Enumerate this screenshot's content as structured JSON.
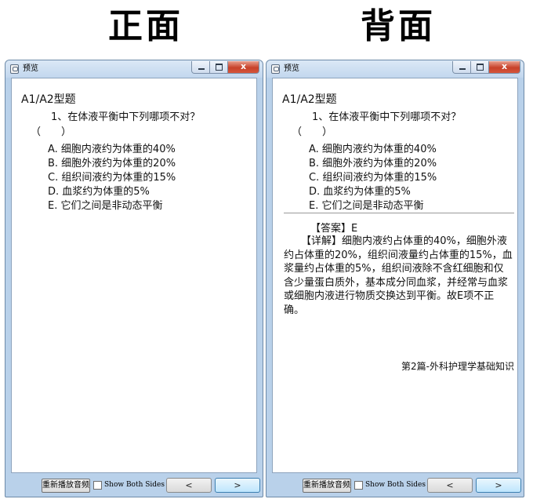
{
  "headings": {
    "front": "正面",
    "back": "背面"
  },
  "window": {
    "title": "预览",
    "close_glyph": "x"
  },
  "question": {
    "section": "A1/A2型题",
    "text": "1、在体液平衡中下列哪项不对？",
    "paren": "（　　）",
    "options": [
      "A. 细胞内液约为体重的40%",
      "B. 细胞外液约为体重的20%",
      "C. 组织间液约为体重的15%",
      "D. 血浆约为体重的5%",
      "E. 它们之间是非动态平衡"
    ]
  },
  "answer": {
    "label": "【答案】E",
    "explanation": "【详解】细胞内液约占体重的40%，细胞外液约占体重的20%，组织间液量约占体重的15%，血浆量约占体重的5%，组织间液除不含红细胞和仅含少量蛋白质外，基本成分同血浆，并经常与血浆或细胞内液进行物质交换达到平衡。故E项不正确。",
    "source": "第2篇-外科护理学基础知识"
  },
  "controls": {
    "replay_label": "重新播放音频",
    "show_both_label": "Show Both Sides",
    "show_both_checked": false,
    "prev_label": "<",
    "next_label": ">"
  },
  "icons": {
    "app": "card-preview-icon",
    "minimize": "minimize-icon",
    "maximize": "maximize-icon",
    "close": "close-icon"
  }
}
